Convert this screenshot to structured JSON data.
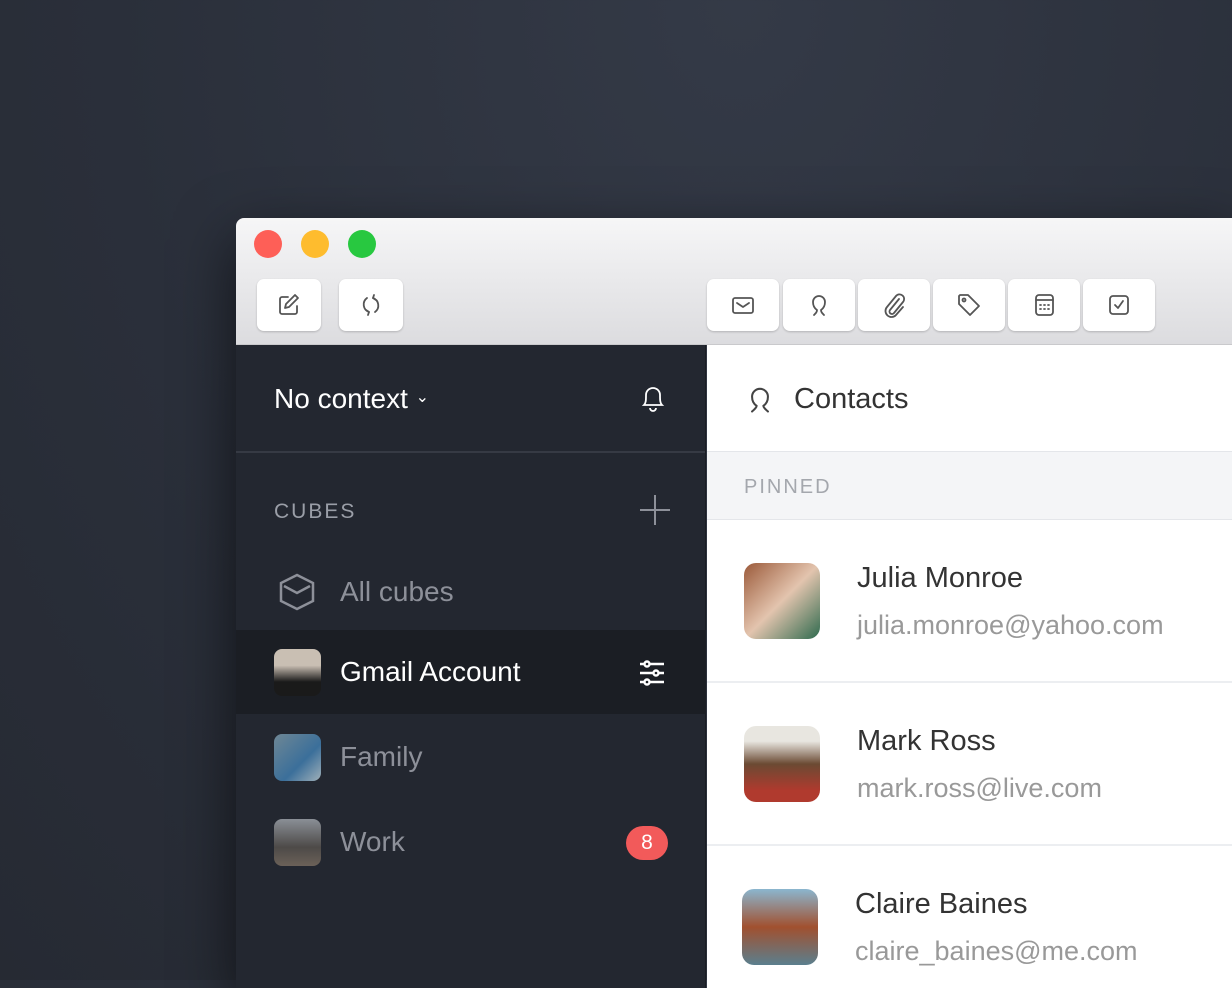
{
  "window": {
    "traffic_lights": {
      "close": "#ff5f57",
      "minimize": "#ffbd2e",
      "zoom": "#28c940"
    }
  },
  "toolbar": {
    "left": [
      {
        "icon": "compose-icon"
      },
      {
        "icon": "refresh-icon"
      }
    ],
    "right": [
      {
        "icon": "mail-icon"
      },
      {
        "icon": "contacts-icon"
      },
      {
        "icon": "attachment-icon"
      },
      {
        "icon": "tag-icon"
      },
      {
        "icon": "calendar-icon"
      },
      {
        "icon": "tasks-icon"
      }
    ]
  },
  "sidebar": {
    "context": "No context",
    "section": "CUBES",
    "items": [
      {
        "label": "All cubes",
        "icon": "cube-icon"
      },
      {
        "label": "Gmail Account",
        "selected": true
      },
      {
        "label": "Family"
      },
      {
        "label": "Work",
        "badge": "8"
      }
    ]
  },
  "main": {
    "title": "Contacts",
    "section": "PINNED",
    "contacts": [
      {
        "name": "Julia Monroe",
        "email": "julia.monroe@yahoo.com"
      },
      {
        "name": "Mark Ross",
        "email": "mark.ross@live.com"
      },
      {
        "name": "Claire Baines",
        "email": "claire_baines@me.com"
      }
    ]
  },
  "colors": {
    "sidebar": "#232730",
    "badge": "#f25a5a"
  }
}
